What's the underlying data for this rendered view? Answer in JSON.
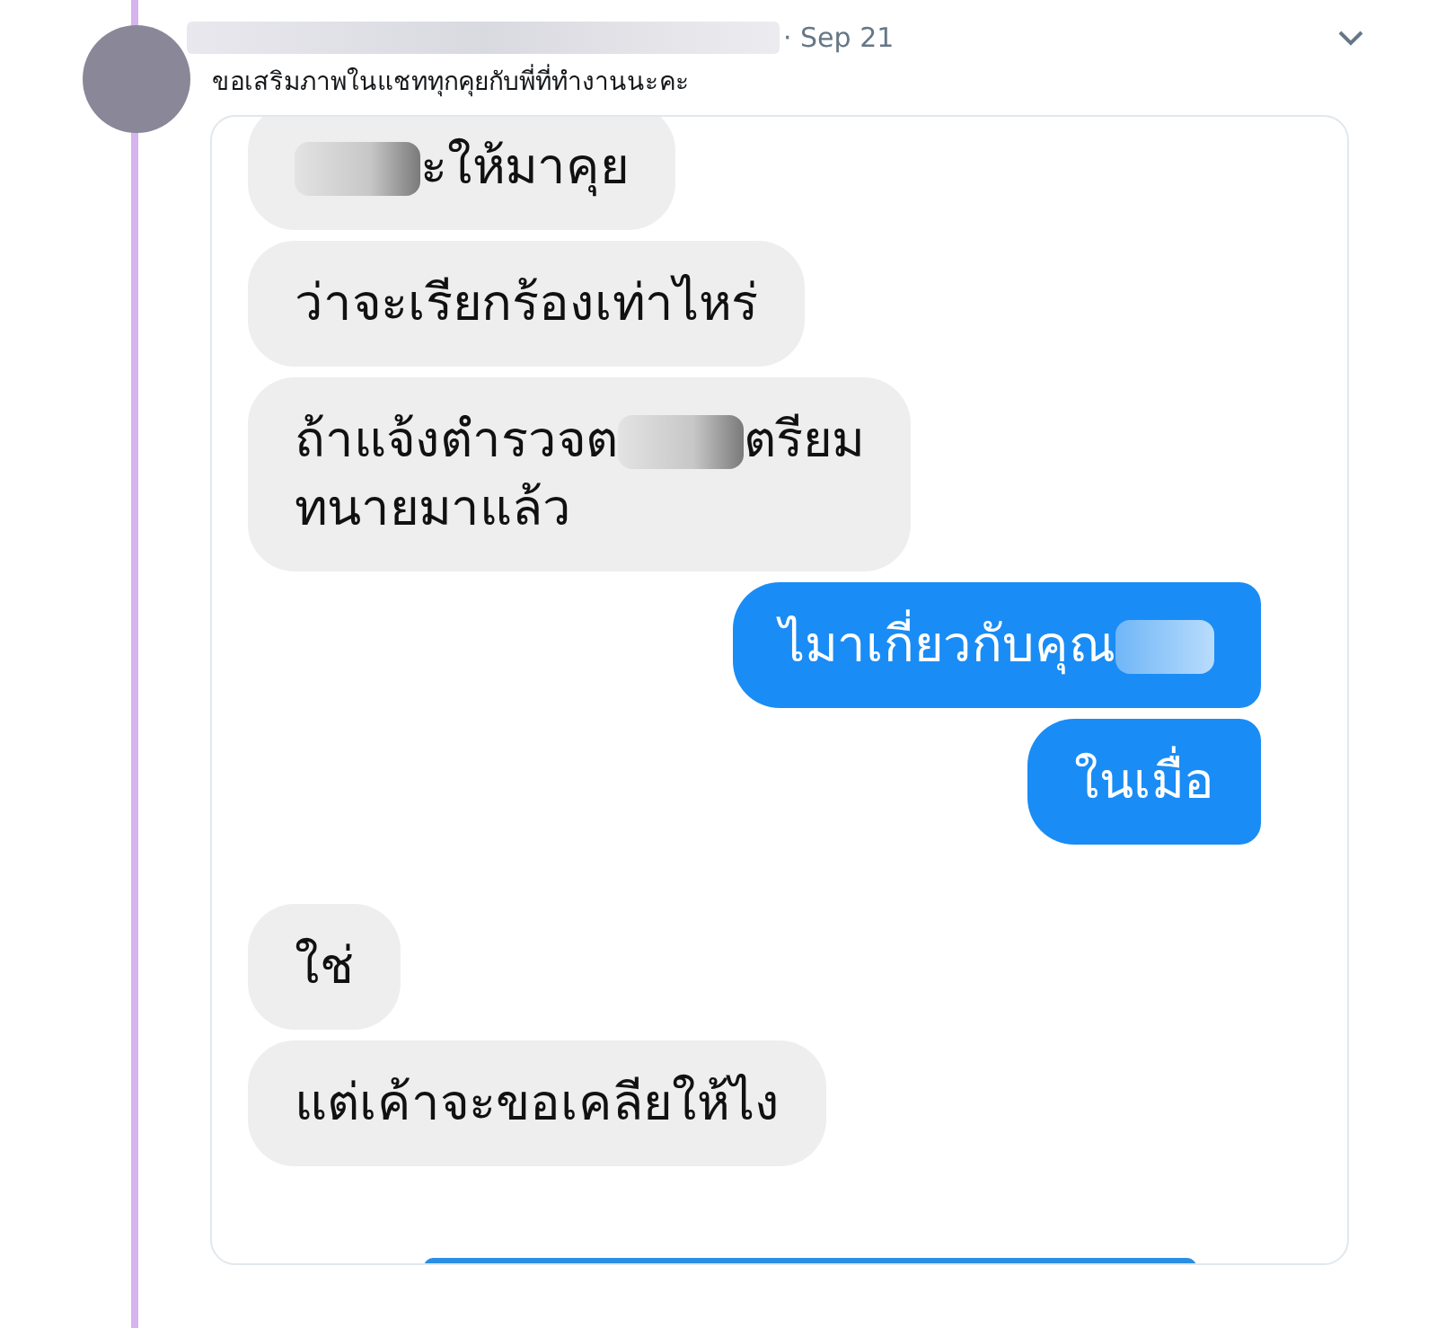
{
  "tweet": {
    "date": "· Sep 21",
    "text": "ขอเสริมภาพในแชททุกคุยกับพี่ที่ทำงานนะคะ"
  },
  "chat": {
    "messages": [
      {
        "kind": "incoming",
        "parts": [
          {
            "kind": "redacted"
          },
          {
            "kind": "text",
            "text": "ะให้มาคุย"
          }
        ]
      },
      {
        "kind": "incoming",
        "parts": [
          {
            "kind": "text",
            "text": "ว่าจะเรียกร้องเท่าไหร่"
          }
        ]
      },
      {
        "kind": "incoming",
        "parts": [
          {
            "kind": "text",
            "text": "ถ้าแจ้งตำรวจต"
          },
          {
            "kind": "redacted"
          },
          {
            "kind": "text",
            "text": "ตรียม"
          },
          {
            "kind": "break"
          },
          {
            "kind": "text",
            "text": "ทนายมาแล้ว"
          }
        ]
      },
      {
        "kind": "outgoing",
        "parts": [
          {
            "kind": "text",
            "text": "ไมาเกี่ยวกับคุณ"
          },
          {
            "kind": "redacted"
          }
        ]
      },
      {
        "kind": "outgoing",
        "parts": [
          {
            "kind": "text",
            "text": "ในเมื่อ"
          }
        ]
      },
      {
        "kind": "spacer"
      },
      {
        "kind": "incoming",
        "parts": [
          {
            "kind": "text",
            "text": "ใช่"
          }
        ]
      },
      {
        "kind": "incoming",
        "parts": [
          {
            "kind": "text",
            "text": "แต่เค้าจะขอเคลียให้ไง"
          }
        ]
      },
      {
        "kind": "cut"
      }
    ]
  }
}
